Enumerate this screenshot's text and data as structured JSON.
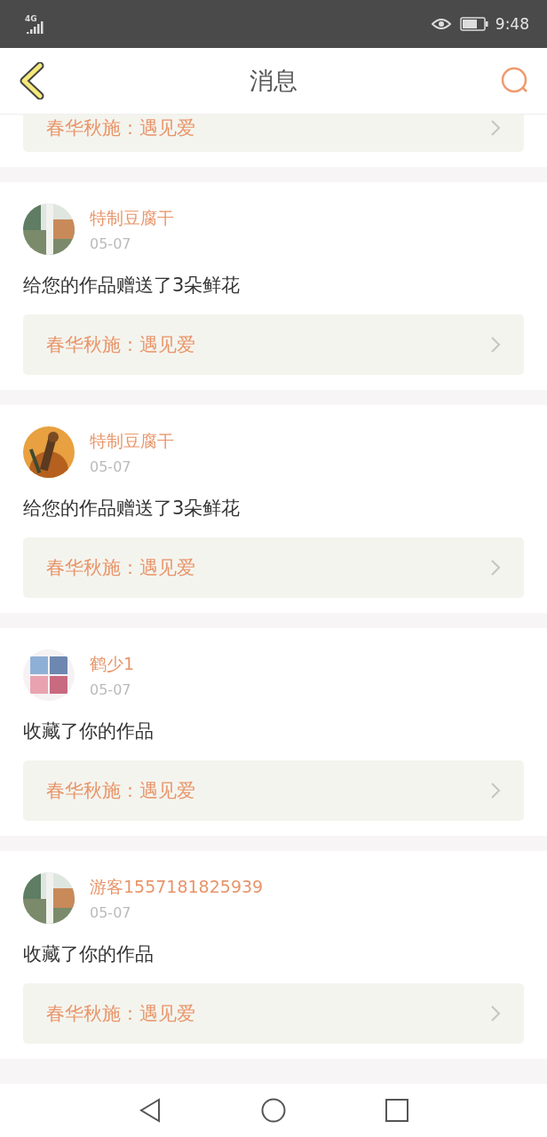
{
  "status_bar": {
    "network": "4G",
    "time": "9:48"
  },
  "nav": {
    "title": "消息"
  },
  "messages": [
    {
      "kind": "partial",
      "work": "春华秋施：遇见爱"
    },
    {
      "kind": "full",
      "user": "特制豆腐干",
      "date": "05-07",
      "text": "给您的作品赠送了3朵鲜花",
      "work": "春华秋施：遇见爱"
    },
    {
      "kind": "full",
      "user": "特制豆腐干",
      "date": "05-07",
      "text": "给您的作品赠送了3朵鲜花",
      "work": "春华秋施：遇见爱"
    },
    {
      "kind": "full",
      "user": "鹤少1",
      "date": "05-07",
      "text": "收藏了你的作品",
      "work": "春华秋施：遇见爱"
    },
    {
      "kind": "full",
      "user": "游客1557181825939",
      "date": "05-07",
      "text": "收藏了你的作品",
      "work": "春华秋施：遇见爱"
    }
  ]
}
